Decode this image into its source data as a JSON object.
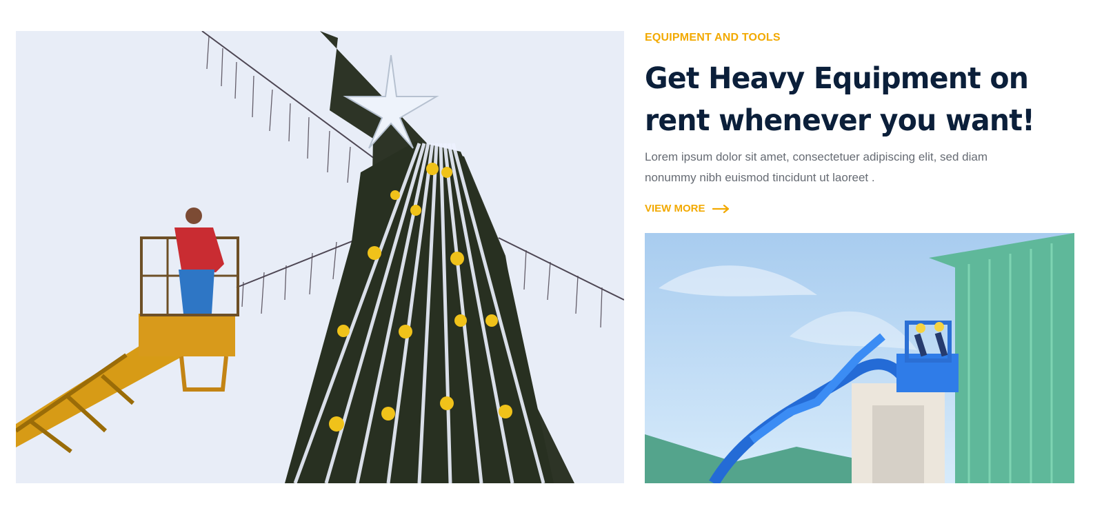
{
  "hero": {
    "image_icon": "christmas-tree-lift-photo"
  },
  "content": {
    "eyebrow": "EQUIPMENT AND TOOLS",
    "title": "Get Heavy Equipment on rent whenever you want!",
    "description": "Lorem ipsum dolor sit amet, consectetuer adipiscing elit, sed diam nonummy nibh euismod tincidunt ut laoreet .",
    "cta_label": "VIEW MORE",
    "cta_icon": "arrow-right-icon"
  },
  "side_image": {
    "image_icon": "boom-lift-building-photo"
  },
  "colors": {
    "accent": "#f2a900",
    "heading": "#0b1f3a",
    "body_text": "#666b73"
  }
}
